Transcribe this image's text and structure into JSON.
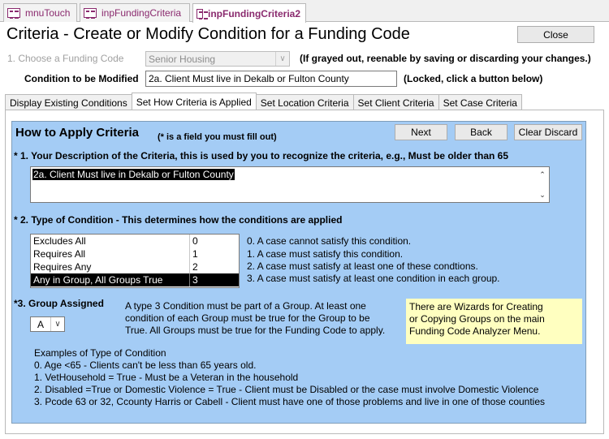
{
  "doc_tabs": [
    {
      "label": "mnuTouch"
    },
    {
      "label": "inpFundingCriteria"
    },
    {
      "label": "inpFundingCriteria2"
    }
  ],
  "form_title": "Criteria - Create or Modify Condition for a Funding Code",
  "close_label": "Close",
  "funding_code": {
    "label": "1. Choose a Funding Code",
    "value": "Senior Housing",
    "note": "(If grayed out, reenable by saving or discarding your changes.)"
  },
  "condition": {
    "label": "Condition to be Modified",
    "value": "2a. Client Must live in Dekalb or Fulton County",
    "note": "(Locked, click a button below)"
  },
  "form_tabs": [
    {
      "label": "Display Existing Conditions"
    },
    {
      "label": "Set How Criteria is Applied"
    },
    {
      "label": "Set Location Criteria"
    },
    {
      "label": "Set Client Criteria"
    },
    {
      "label": "Set Case Criteria"
    }
  ],
  "panel": {
    "heading": "How to Apply Criteria",
    "required_note": "(* is a field you must fill out)",
    "next_label": "Next",
    "back_label": "Back",
    "clear_label": "Clear Discard",
    "q1_label": "* 1. Your Description of the Criteria, this is used by you to recognize the criteria, e.g., Must be older than 65",
    "q1_value": "2a. Client Must live in Dekalb or Fulton County",
    "q2_label": "* 2. Type of Condition - This determines how the conditions are applied",
    "condition_types": [
      {
        "name": "Excludes All",
        "code": "0"
      },
      {
        "name": "Requires All",
        "code": "1"
      },
      {
        "name": "Requires Any",
        "code": "2"
      },
      {
        "name": "Any in Group, All Groups True",
        "code": "3"
      }
    ],
    "type_descriptions": [
      "0. A case cannot satisfy this condition.",
      "1. A case must satisfy this condition.",
      "2. A case must satisfy at least one of these condtions.",
      "3. A case must satisfy at least one condition in each group."
    ],
    "q3_label": "*3. Group Assigned",
    "group_value": "A",
    "group_text": [
      "A type 3 Condition must be part of a Group. At least one",
      "condition of each Group must be true for the Group to be",
      "True. All Groups must be true for the Funding Code to apply."
    ],
    "wizard_note": [
      "There are Wizards for Creating",
      "or Copying Groups on the main",
      "Funding Code Analyzer Menu."
    ],
    "examples": [
      "Examples of Type of Condition",
      "0. Age <65 - Clients can't be less than 65 years old.",
      "1. VetHousehold = True - Must be a Veteran in the household",
      "2. Disabled =True or Domestic Violence = True - Client must be Disabled or the case must involve Domestic Violence",
      "3. Pcode 63 or 32, Ccounty Harris or Cabell - Client must have one of those problems and live in one of those counties"
    ]
  }
}
